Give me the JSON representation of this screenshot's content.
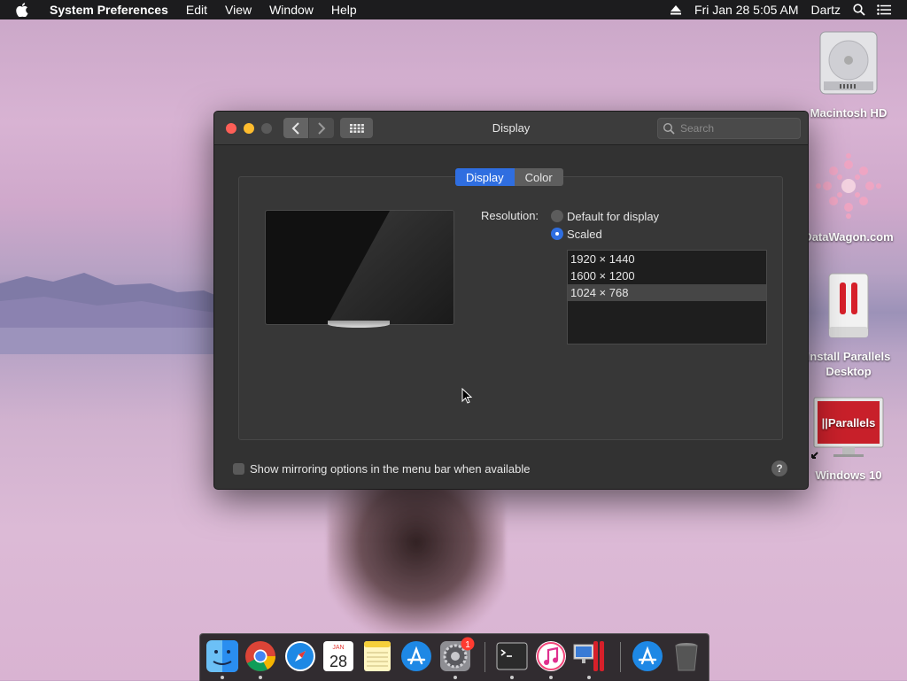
{
  "menubar": {
    "app_name": "System Preferences",
    "menus": [
      "Edit",
      "View",
      "Window",
      "Help"
    ],
    "datetime": "Fri Jan 28  5:05 AM",
    "user": "Dartz"
  },
  "desktop_icons": [
    {
      "label": "Macintosh HD",
      "icon": "hard-drive-icon"
    },
    {
      "label": "DataWagon.com",
      "icon": "datawagon-icon"
    },
    {
      "label": "Install Parallels Desktop",
      "icon": "parallels-installer-icon"
    },
    {
      "label": "Windows 10",
      "icon": "parallels-vm-icon"
    }
  ],
  "window": {
    "title": "Display",
    "search_placeholder": "Search",
    "tabs": [
      {
        "label": "Display",
        "active": true
      },
      {
        "label": "Color",
        "active": false
      }
    ],
    "resolution_label": "Resolution:",
    "options": [
      {
        "label": "Default for display",
        "selected": false
      },
      {
        "label": "Scaled",
        "selected": true
      }
    ],
    "resolutions": [
      {
        "label": "1920 × 1440",
        "selected": false
      },
      {
        "label": "1600 × 1200",
        "selected": false
      },
      {
        "label": "1024 × 768",
        "selected": true
      }
    ],
    "mirroring_label": "Show mirroring options in the menu bar when available",
    "mirroring_checked": false,
    "help_label": "?"
  },
  "dock": {
    "apps": [
      "finder-icon",
      "chrome-icon",
      "safari-icon",
      "calendar-icon",
      "notes-icon",
      "app-store-icon",
      "system-preferences-icon",
      "terminal-icon",
      "itunes-icon",
      "parallels-icon",
      "app-store-downloads-icon",
      "trash-icon"
    ],
    "calendar_month": "JAN",
    "calendar_day": "28",
    "badge_count": "1"
  },
  "colors": {
    "accent": "#2f6ee0",
    "window_bg": "#323232",
    "menubar_bg": "#1c1c1e"
  }
}
